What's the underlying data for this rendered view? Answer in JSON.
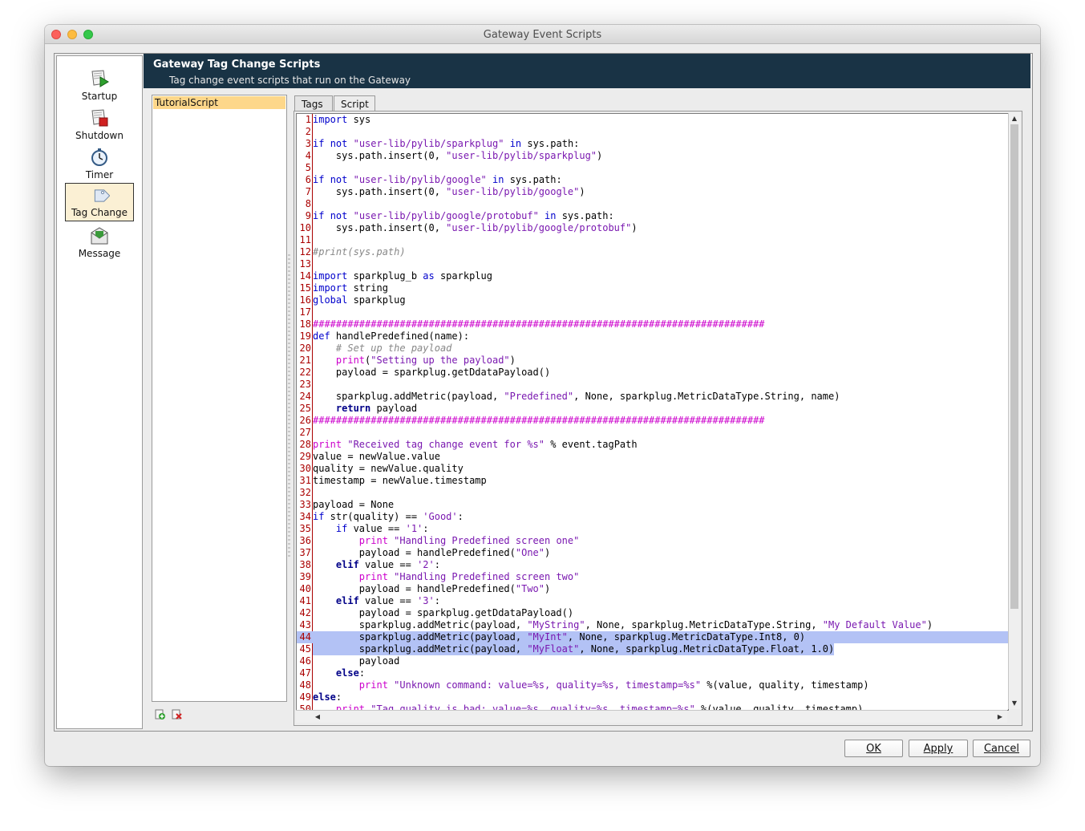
{
  "window": {
    "title": "Gateway Event Scripts"
  },
  "events": [
    {
      "label": "Startup",
      "icon": "startup-icon"
    },
    {
      "label": "Shutdown",
      "icon": "shutdown-icon"
    },
    {
      "label": "Timer",
      "icon": "timer-icon"
    },
    {
      "label": "Tag Change",
      "icon": "tag-icon",
      "selected": true
    },
    {
      "label": "Message",
      "icon": "message-icon"
    }
  ],
  "header": {
    "title": "Gateway Tag Change Scripts",
    "subtitle": "Tag change event scripts that run on the Gateway"
  },
  "scripts": {
    "items": [
      "TutorialScript"
    ]
  },
  "tabs": {
    "tags": "Tags",
    "script": "Script"
  },
  "editor": {
    "highlighted_lines": [
      44,
      45
    ],
    "lines": [
      "import sys",
      "",
      "if not \"user-lib/pylib/sparkplug\" in sys.path:",
      "    sys.path.insert(0, \"user-lib/pylib/sparkplug\")",
      "",
      "if not \"user-lib/pylib/google\" in sys.path:",
      "    sys.path.insert(0, \"user-lib/pylib/google\")",
      "",
      "if not \"user-lib/pylib/google/protobuf\" in sys.path:",
      "    sys.path.insert(0, \"user-lib/pylib/google/protobuf\")",
      "",
      "#print(sys.path)",
      "",
      "import sparkplug_b as sparkplug",
      "import string",
      "global sparkplug",
      "",
      "##############################################################################",
      "def handlePredefined(name):",
      "    # Set up the payload",
      "    print(\"Setting up the payload\")",
      "    payload = sparkplug.getDdataPayload()",
      "",
      "    sparkplug.addMetric(payload, \"Predefined\", None, sparkplug.MetricDataType.String, name)",
      "    return payload",
      "##############################################################################",
      "",
      "print \"Received tag change event for %s\" % event.tagPath",
      "value = newValue.value",
      "quality = newValue.quality",
      "timestamp = newValue.timestamp",
      "",
      "payload = None",
      "if str(quality) == 'Good':",
      "    if value == '1':",
      "        print \"Handling Predefined screen one\"",
      "        payload = handlePredefined(\"One\")",
      "    elif value == '2':",
      "        print \"Handling Predefined screen two\"",
      "        payload = handlePredefined(\"Two\")",
      "    elif value == '3':",
      "        payload = sparkplug.getDdataPayload()",
      "        sparkplug.addMetric(payload, \"MyString\", None, sparkplug.MetricDataType.String, \"My Default Value\")",
      "        sparkplug.addMetric(payload, \"MyInt\", None, sparkplug.MetricDataType.Int8, 0)",
      "        sparkplug.addMetric(payload, \"MyFloat\", None, sparkplug.MetricDataType.Float, 1.0)",
      "        payload",
      "    else:",
      "        print \"Unknown command: value=%s, quality=%s, timestamp=%s\" %(value, quality, timestamp)",
      "else:",
      "    print \"Tag quality is bad: value=%s, quality=%s, timestamp=%s\" %(value, quality, timestamp)"
    ]
  },
  "buttons": {
    "ok": "OK",
    "apply": "Apply",
    "cancel": "Cancel"
  },
  "colors": {
    "header_bg": "#193345",
    "selection": "#b3c2f5",
    "list_selected": "#fdd78a",
    "line_number": "#aa0000"
  }
}
